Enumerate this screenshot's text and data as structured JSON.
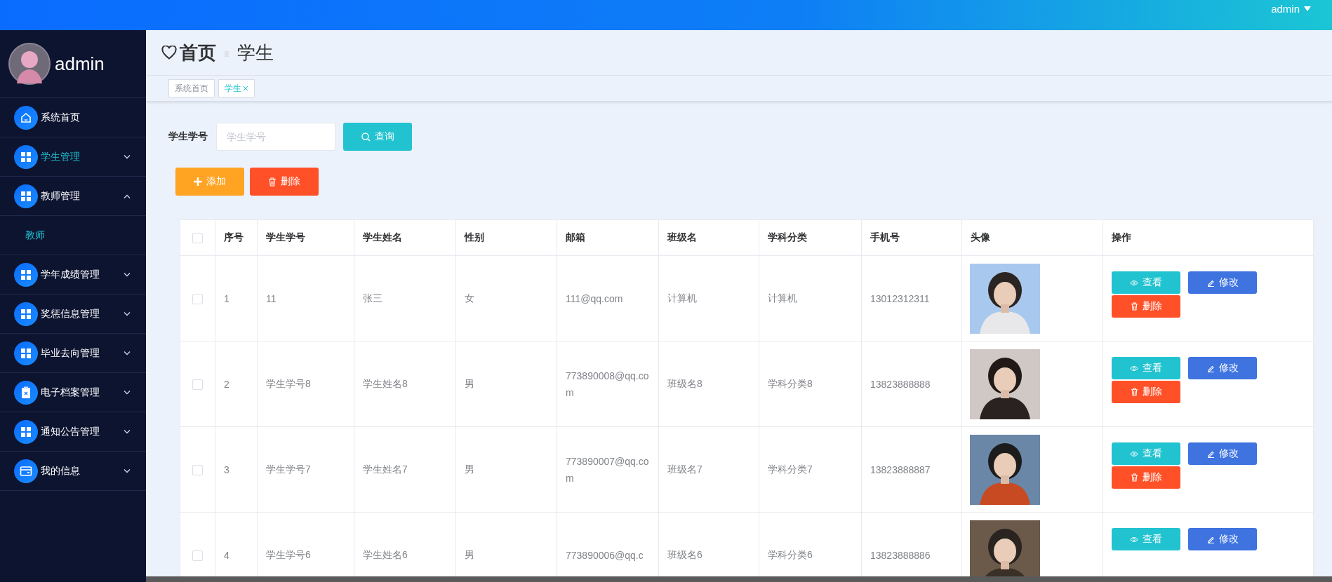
{
  "top_bar": {
    "user": "admin"
  },
  "sidebar": {
    "user": "admin",
    "items": [
      {
        "label": "系统首页",
        "kind": "home",
        "selected": false
      },
      {
        "label": "学生管理",
        "kind": "menu",
        "selected": true,
        "expanded": false
      },
      {
        "label": "教师管理",
        "kind": "menu",
        "selected": false,
        "expanded": true,
        "children": [
          {
            "label": "教师",
            "selected": true
          }
        ]
      },
      {
        "label": "学年成绩管理",
        "kind": "menu",
        "selected": false,
        "expanded": false
      },
      {
        "label": "奖惩信息管理",
        "kind": "menu",
        "selected": false,
        "expanded": false
      },
      {
        "label": "毕业去向管理",
        "kind": "menu",
        "selected": false,
        "expanded": false
      },
      {
        "label": "电子档案管理",
        "kind": "archive",
        "selected": false,
        "expanded": false
      },
      {
        "label": "通知公告管理",
        "kind": "menu",
        "selected": false,
        "expanded": false
      },
      {
        "label": "我的信息",
        "kind": "account",
        "selected": false,
        "expanded": false
      }
    ]
  },
  "breadcrumb": {
    "home": "首页",
    "current": "学生"
  },
  "tabs": [
    {
      "label": "系统首页",
      "selected": false,
      "closable": false
    },
    {
      "label": "学生",
      "selected": true,
      "closable": true
    }
  ],
  "search": {
    "label": "学生学号",
    "placeholder": "学生学号",
    "button": "查询"
  },
  "actions": {
    "add": "添加",
    "delete": "删除"
  },
  "table": {
    "header_checked": false,
    "columns": [
      "序号",
      "学生学号",
      "学生姓名",
      "性别",
      "邮箱",
      "班级名",
      "学科分类",
      "手机号",
      "头像",
      "操作"
    ],
    "rows": [
      {
        "checked": false,
        "cells": [
          "1",
          "11",
          "张三",
          "女",
          "111@qq.com",
          "计算机",
          "计算机",
          "13012312311"
        ],
        "buttons": [
          "查看",
          "修改",
          "删除"
        ]
      },
      {
        "checked": false,
        "cells": [
          "2",
          "学生学号8",
          "学生姓名8",
          "男",
          "773890008@qq.com",
          "班级名8",
          "学科分类8",
          "13823888888"
        ],
        "buttons": [
          "查看",
          "修改",
          "删除"
        ]
      },
      {
        "checked": false,
        "cells": [
          "3",
          "学生学号7",
          "学生姓名7",
          "男",
          "773890007@qq.com",
          "班级名7",
          "学科分类7",
          "13823888887"
        ],
        "buttons": [
          "查看",
          "修改",
          "删除"
        ]
      },
      {
        "checked": false,
        "cells": [
          "4",
          "学生学号6",
          "学生姓名6",
          "男",
          "773890006@qq.c",
          "班级名6",
          "学科分类6",
          "13823888886"
        ],
        "buttons": [
          "查看",
          "修改"
        ]
      }
    ]
  }
}
